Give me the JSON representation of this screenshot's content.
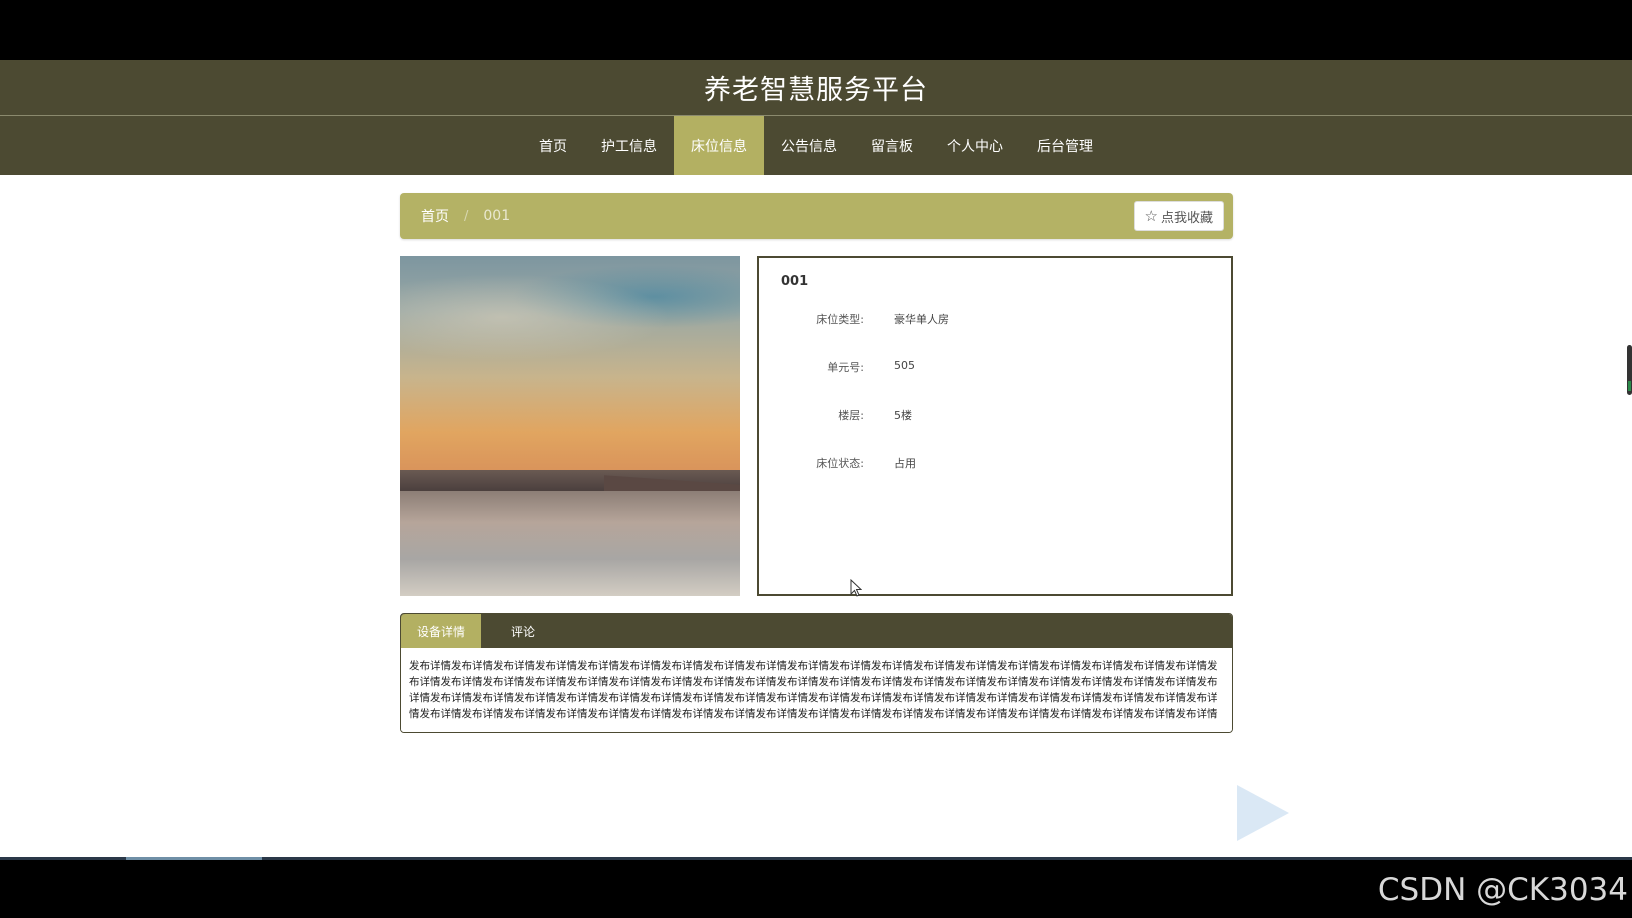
{
  "header": {
    "title": "养老智慧服务平台"
  },
  "nav": {
    "items": [
      {
        "label": "首页"
      },
      {
        "label": "护工信息"
      },
      {
        "label": "床位信息"
      },
      {
        "label": "公告信息"
      },
      {
        "label": "留言板"
      },
      {
        "label": "个人中心"
      },
      {
        "label": "后台管理"
      }
    ],
    "active_index": 2
  },
  "breadcrumb": {
    "home": "首页",
    "separator": "/",
    "current": "001",
    "favorite_label": "点我收藏",
    "favorite_icon": "star-icon"
  },
  "detail": {
    "title": "001",
    "fields": [
      {
        "label": "床位类型:",
        "value": "豪华单人房"
      },
      {
        "label": "单元号:",
        "value": "505"
      },
      {
        "label": "楼层:",
        "value": "5楼"
      },
      {
        "label": "床位状态:",
        "value": "占用"
      }
    ]
  },
  "tabs": {
    "items": [
      {
        "label": "设备详情"
      },
      {
        "label": "评论"
      }
    ],
    "active_index": 0,
    "content": "发布详情发布详情发布详情发布详情发布详情发布详情发布详情发布详情发布详情发布详情发布详情发布详情发布详情发布详情发布详情发布详情发布详情发布详情发布详情发布详情发布详情发布详情发布详情发布详情发布详情发布详情发布详情发布详情发布详情发布详情发布详情发布详情发布详情发布详情发布详情发布详情发布详情发布详情发布详情发布详情发布详情发布详情发布详情发布详情发布详情发布详情发布详情发布详情发布详情发布详情发布详情发布详情发布详情发布详情发布详情发布详情发布详情发布详情发布详情发布详情发布详情发布详情发布详情发布详情发布详情发布详情发布详情发布详情发布详情发布详情发布详情发布详情发布详情发布详情发布详情发布详情发布详情"
  },
  "watermark": "CSDN @CK3034",
  "colors": {
    "header_bg": "#4c4a32",
    "accent": "#b3b062",
    "breadcrumb_bg": "#b4b265"
  }
}
